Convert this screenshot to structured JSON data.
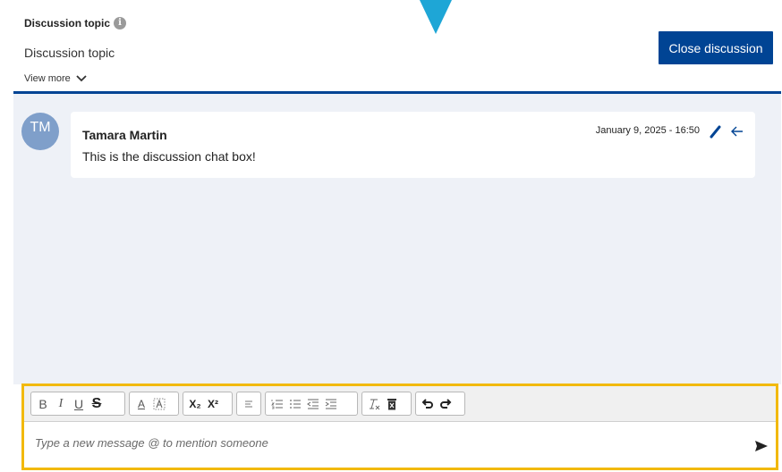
{
  "header": {
    "topic_label": "Discussion topic",
    "topic_value": "Discussion topic",
    "view_more": "View more",
    "close_button": "Close discussion",
    "info_glyph": "i"
  },
  "chat": {
    "messages": [
      {
        "avatar_initials": "TM",
        "author": "Tamara Martin",
        "timestamp": "January 9, 2025 - 16:50",
        "text": "This is the discussion chat box!"
      }
    ]
  },
  "editor": {
    "placeholder": "Type a new message @ to mention someone",
    "toolbar": {
      "bold": "B",
      "italic": "I",
      "underline": "U",
      "strikethrough": "S",
      "font_color": "A",
      "subscript": "X₂",
      "superscript": "X²"
    }
  },
  "colors": {
    "brand": "#004494",
    "highlight_frame": "#f2b90d",
    "pointer": "#1ea6d6",
    "chat_bg": "#eef1f7",
    "avatar": "#7f9fca"
  },
  "icons": {
    "info": "info-icon",
    "view_more": "chevron-down-icon",
    "edit": "pencil-icon",
    "reply": "reply-icon",
    "send": "send-icon",
    "pointer": "pointer-arrow-icon"
  }
}
